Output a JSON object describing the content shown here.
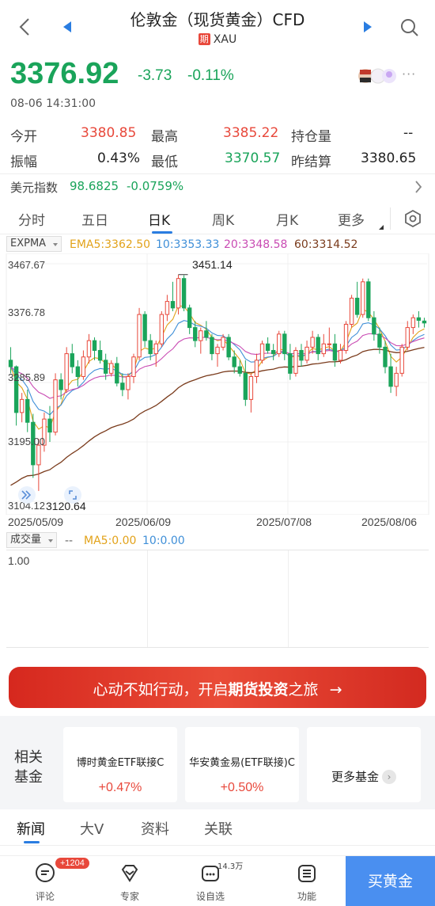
{
  "header": {
    "title": "伦敦金（现货黄金）CFD",
    "tag": "期",
    "symbol": "XAU"
  },
  "quote": {
    "price": "3376.92",
    "change": "-3.73",
    "change_pct": "-0.11%",
    "datetime": "08-06 14:31:00",
    "more": "···"
  },
  "stats": {
    "open_label": "今开",
    "open": "3380.85",
    "high_label": "最高",
    "high": "3385.22",
    "oi_label": "持仓量",
    "oi": "--",
    "amp_label": "振幅",
    "amp": "0.43%",
    "low_label": "最低",
    "low": "3370.57",
    "prev_label": "昨结算",
    "prev": "3380.65"
  },
  "usd_index": {
    "label": "美元指数",
    "value": "98.6825",
    "change": "-0.0759%"
  },
  "period_tabs": [
    "分时",
    "五日",
    "日K",
    "周K",
    "月K",
    "更多"
  ],
  "indicators": {
    "selector": "EXPMA",
    "ema5": "EMA5:3362.50",
    "ema10": "10:3353.33",
    "ema20": "20:3348.58",
    "ema60": "60:3314.52"
  },
  "chart_data": {
    "type": "candlestick",
    "y_ticks": [
      "3467.67",
      "3376.78",
      "3285.89",
      "3195.00",
      "3104.12"
    ],
    "x_ticks": [
      "2025/05/09",
      "2025/06/09",
      "2025/07/08",
      "2025/08/06"
    ],
    "high_marker": "3451.14",
    "low_marker": "3120.64",
    "ylim": [
      3104.12,
      3467.67
    ],
    "candles": [
      [
        3320,
        3340,
        3300,
        3310
      ],
      [
        3310,
        3312,
        3220,
        3240
      ],
      [
        3240,
        3270,
        3225,
        3260
      ],
      [
        3260,
        3275,
        3210,
        3225
      ],
      [
        3225,
        3238,
        3140,
        3160
      ],
      [
        3160,
        3200,
        3120,
        3190
      ],
      [
        3190,
        3240,
        3180,
        3230
      ],
      [
        3230,
        3250,
        3195,
        3210
      ],
      [
        3210,
        3300,
        3205,
        3290
      ],
      [
        3290,
        3300,
        3260,
        3275
      ],
      [
        3275,
        3340,
        3270,
        3330
      ],
      [
        3330,
        3345,
        3300,
        3310
      ],
      [
        3310,
        3320,
        3280,
        3295
      ],
      [
        3295,
        3335,
        3290,
        3325
      ],
      [
        3325,
        3360,
        3315,
        3350
      ],
      [
        3350,
        3355,
        3320,
        3335
      ],
      [
        3335,
        3350,
        3315,
        3320
      ],
      [
        3320,
        3330,
        3290,
        3300
      ],
      [
        3300,
        3320,
        3295,
        3315
      ],
      [
        3315,
        3325,
        3280,
        3285
      ],
      [
        3285,
        3300,
        3265,
        3275
      ],
      [
        3275,
        3300,
        3260,
        3295
      ],
      [
        3295,
        3330,
        3285,
        3325
      ],
      [
        3325,
        3400,
        3320,
        3390
      ],
      [
        3390,
        3395,
        3340,
        3350
      ],
      [
        3350,
        3360,
        3320,
        3330
      ],
      [
        3330,
        3350,
        3310,
        3345
      ],
      [
        3345,
        3395,
        3340,
        3390
      ],
      [
        3390,
        3420,
        3380,
        3410
      ],
      [
        3410,
        3440,
        3395,
        3400
      ],
      [
        3400,
        3451,
        3390,
        3445
      ],
      [
        3445,
        3450,
        3395,
        3400
      ],
      [
        3400,
        3405,
        3360,
        3370
      ],
      [
        3370,
        3380,
        3340,
        3350
      ],
      [
        3350,
        3370,
        3330,
        3365
      ],
      [
        3365,
        3380,
        3350,
        3355
      ],
      [
        3355,
        3360,
        3320,
        3330
      ],
      [
        3330,
        3345,
        3310,
        3340
      ],
      [
        3340,
        3360,
        3335,
        3355
      ],
      [
        3355,
        3360,
        3320,
        3325
      ],
      [
        3325,
        3335,
        3300,
        3310
      ],
      [
        3310,
        3320,
        3295,
        3300
      ],
      [
        3300,
        3320,
        3250,
        3260
      ],
      [
        3260,
        3300,
        3240,
        3295
      ],
      [
        3295,
        3330,
        3285,
        3320
      ],
      [
        3320,
        3350,
        3315,
        3345
      ],
      [
        3345,
        3355,
        3330,
        3335
      ],
      [
        3335,
        3345,
        3320,
        3330
      ],
      [
        3330,
        3365,
        3325,
        3360
      ],
      [
        3360,
        3365,
        3320,
        3330
      ],
      [
        3330,
        3345,
        3290,
        3300
      ],
      [
        3300,
        3340,
        3295,
        3335
      ],
      [
        3335,
        3345,
        3310,
        3320
      ],
      [
        3320,
        3350,
        3315,
        3340
      ],
      [
        3340,
        3365,
        3330,
        3355
      ],
      [
        3355,
        3360,
        3320,
        3330
      ],
      [
        3330,
        3360,
        3325,
        3345
      ],
      [
        3345,
        3370,
        3335,
        3345
      ],
      [
        3345,
        3360,
        3310,
        3320
      ],
      [
        3320,
        3345,
        3315,
        3335
      ],
      [
        3335,
        3380,
        3330,
        3375
      ],
      [
        3375,
        3420,
        3370,
        3415
      ],
      [
        3415,
        3440,
        3385,
        3390
      ],
      [
        3390,
        3445,
        3385,
        3440
      ],
      [
        3440,
        3445,
        3380,
        3385
      ],
      [
        3385,
        3395,
        3350,
        3360
      ],
      [
        3360,
        3370,
        3330,
        3340
      ],
      [
        3340,
        3350,
        3300,
        3310
      ],
      [
        3310,
        3330,
        3270,
        3280
      ],
      [
        3280,
        3310,
        3265,
        3300
      ],
      [
        3300,
        3345,
        3295,
        3340
      ],
      [
        3340,
        3380,
        3335,
        3370
      ],
      [
        3370,
        3390,
        3360,
        3385
      ],
      [
        3385,
        3395,
        3370,
        3381
      ],
      [
        3380,
        3385,
        3370,
        3377
      ]
    ]
  },
  "volume": {
    "selector": "成交量",
    "dashes": "--",
    "ma5": "MA5:0.00",
    "ma10": "10:0.00",
    "scale": "1.00"
  },
  "banner": {
    "text_a": "心动不如行动，开启",
    "text_b": "期货投资",
    "text_c": "之旅",
    "arrow": "→"
  },
  "funds": {
    "label_1": "相关",
    "label_2": "基金",
    "items": [
      {
        "name": "博时黄金ETF联接C",
        "change": "+0.47%"
      },
      {
        "name": "华安黄金易(ETF联接)C",
        "change": "+0.50%"
      }
    ],
    "more": "更多基金",
    "more_arrow": "›"
  },
  "news_tabs": [
    "新闻",
    "大V",
    "资料",
    "关联"
  ],
  "bottom_bar": {
    "comment": "评论",
    "comment_badge": "+1204",
    "expert": "专家",
    "watch": "设自选",
    "watch_count": "14.3万",
    "func": "功能",
    "buy": "买黄金"
  },
  "colors": {
    "up": "#e8483b",
    "down": "#1aa45a",
    "accent": "#2a7de1",
    "ema5": "#e2a21a",
    "ema10": "#3f8fd8",
    "ema20": "#c94bb3",
    "ema60": "#7a3b1c"
  }
}
